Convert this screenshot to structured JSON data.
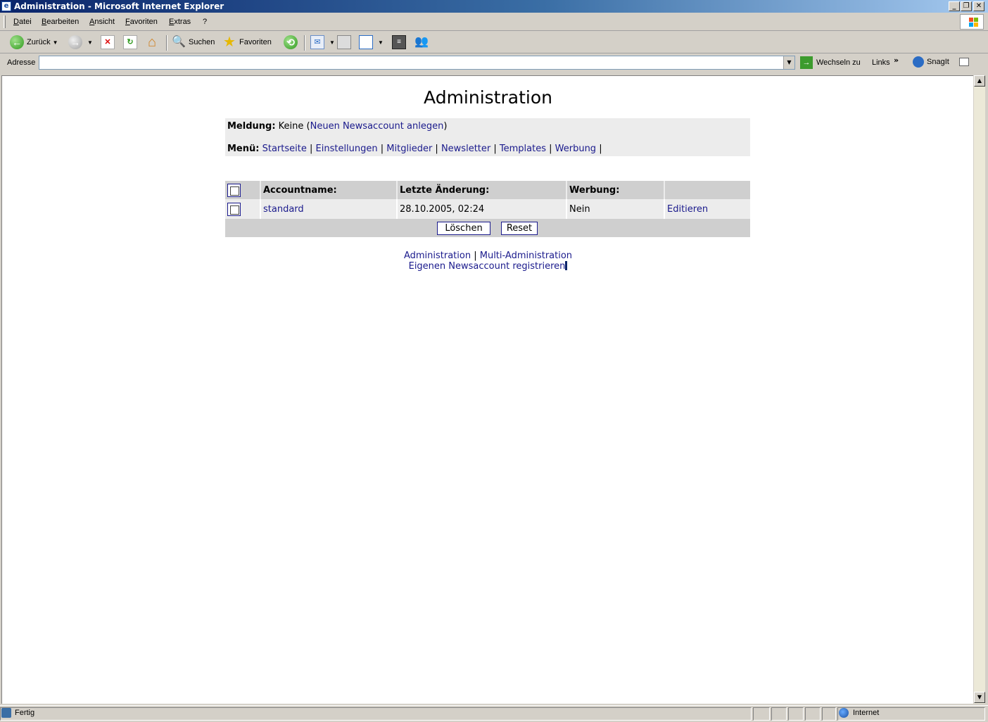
{
  "window": {
    "title": "Administration - Microsoft Internet Explorer"
  },
  "menubar": {
    "items": [
      "Datei",
      "Bearbeiten",
      "Ansicht",
      "Favoriten",
      "Extras",
      "?"
    ]
  },
  "toolbar": {
    "back_label": "Zurück",
    "search_label": "Suchen",
    "favorites_label": "Favoriten"
  },
  "addressbar": {
    "label": "Adresse",
    "value": "",
    "go_label": "Wechseln zu",
    "links_label": "Links",
    "snagit_label": "SnagIt"
  },
  "page": {
    "title": "Administration",
    "message_label": "Meldung:",
    "message_value": "Keine",
    "message_link": "Neuen Newsaccount anlegen",
    "menu_label": "Menü:",
    "menu_items": [
      "Startseite",
      "Einstellungen",
      "Mitglieder",
      "Newsletter",
      "Templates",
      "Werbung"
    ],
    "table": {
      "headers": [
        "Accountname:",
        "Letzte Änderung:",
        "Werbung:",
        ""
      ],
      "rows": [
        {
          "account": "standard",
          "changed": "28.10.2005, 02:24",
          "ads": "Nein",
          "action": "Editieren"
        }
      ]
    },
    "buttons": {
      "delete": "Löschen",
      "reset": "Reset"
    },
    "footer": {
      "link1": "Administration",
      "link2": "Multi-Administration",
      "link3": "Eigenen Newsaccount registrieren"
    }
  },
  "statusbar": {
    "text": "Fertig",
    "zone": "Internet"
  }
}
